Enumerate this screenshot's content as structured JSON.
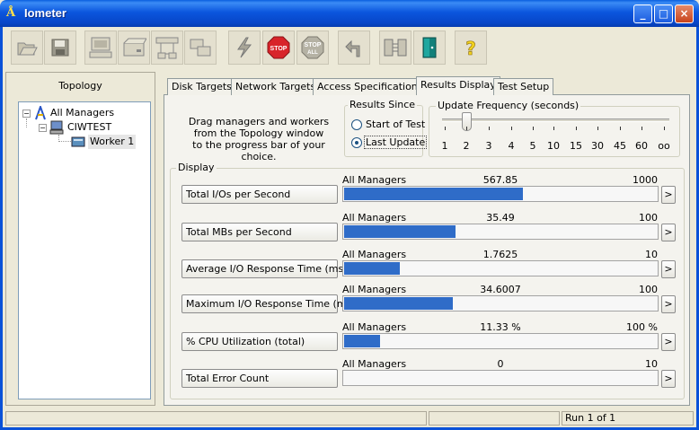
{
  "window": {
    "title": "Iometer",
    "minimize": "_",
    "maximize": "□",
    "close": "×"
  },
  "toolbar": [
    {
      "icon": "open-folder-icon"
    },
    {
      "icon": "save-disk-icon"
    },
    {
      "icon": "display-icon"
    },
    {
      "icon": "disk-worker-icon"
    },
    {
      "icon": "network-worker-icon"
    },
    {
      "icon": "copy-worker-icon"
    },
    {
      "icon": "start-lightning-icon"
    },
    {
      "icon": "stop-icon",
      "label": "STOP"
    },
    {
      "icon": "stop-all-icon",
      "label": "STOP",
      "sublabel": "ALL"
    },
    {
      "icon": "reset-arrow-icon"
    },
    {
      "icon": "disconnect-icon"
    },
    {
      "icon": "exit-door-icon"
    },
    {
      "icon": "help-icon",
      "label": "?"
    }
  ],
  "topology": {
    "title": "Topology",
    "tree": [
      {
        "label": "All Managers",
        "icon": "all-managers-icon",
        "expander": "−"
      },
      {
        "label": "CIWTEST",
        "icon": "computer-icon",
        "expander": "−"
      },
      {
        "label": "Worker 1",
        "icon": "worker-disk-icon"
      }
    ]
  },
  "tabs": [
    "Disk Targets",
    "Network Targets",
    "Access Specifications",
    "Results Display",
    "Test Setup"
  ],
  "active_tab": 3,
  "drag_note": "Drag managers and workers\nfrom the Topology window\nto the progress bar of your choice.",
  "results_since": {
    "legend": "Results Since",
    "options": [
      {
        "label": "Start of Test",
        "selected": false
      },
      {
        "label": "Last Update",
        "selected": true
      }
    ]
  },
  "update_frequency": {
    "legend": "Update Frequency (seconds)",
    "ticks": [
      "1",
      "2",
      "3",
      "4",
      "5",
      "10",
      "15",
      "30",
      "45",
      "60",
      "oo"
    ],
    "selected": "2"
  },
  "display": {
    "legend": "Display",
    "metrics": [
      {
        "button": "Total I/Os per Second",
        "manager": "All Managers",
        "value": "567.85",
        "max": "1000",
        "fill": 0.56785
      },
      {
        "button": "Total MBs per Second",
        "manager": "All Managers",
        "value": "35.49",
        "max": "100",
        "fill": 0.3549
      },
      {
        "button": "Average I/O Response Time (ms)",
        "manager": "All Managers",
        "value": "1.7625",
        "max": "10",
        "fill": 0.17625
      },
      {
        "button": "Maximum I/O Response Time (ms)",
        "manager": "All Managers",
        "value": "34.6007",
        "max": "100",
        "fill": 0.346007
      },
      {
        "button": "% CPU Utilization (total)",
        "manager": "All Managers",
        "value": "11.33 %",
        "max": "100 %",
        "fill": 0.1133
      },
      {
        "button": "Total Error Count",
        "manager": "All Managers",
        "value": "0",
        "max": "10",
        "fill": 0
      }
    ],
    "arrow": ">"
  },
  "status": {
    "run": "Run 1 of 1"
  },
  "colors": {
    "titlebar": "#0b56de",
    "bar_fill": "#2f6cc8",
    "face": "#ece9d8"
  }
}
